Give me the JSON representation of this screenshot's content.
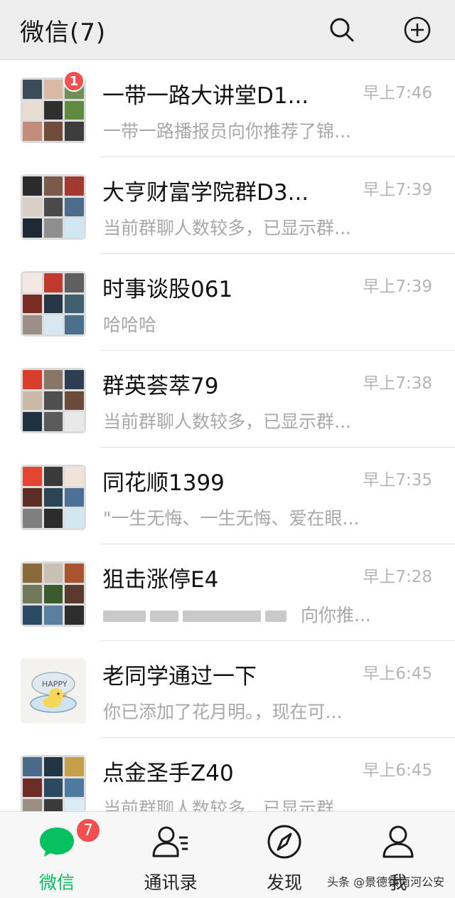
{
  "header": {
    "title": "微信(7)",
    "search_icon": "search-icon",
    "add_icon": "plus-circle-icon"
  },
  "colors": {
    "accent": "#07c160",
    "badge": "#f25050",
    "header_bg": "#ededed"
  },
  "chats": [
    {
      "name": "一带一路大讲堂D1...",
      "time": "早上7:46",
      "preview": "一带一路播报员向你推荐了锦...",
      "unread": "1"
    },
    {
      "name": "大亨财富学院群D3...",
      "time": "早上7:39",
      "preview": "当前群聊人数较多，已显示群..."
    },
    {
      "name": "时事谈股061",
      "time": "早上7:39",
      "preview": "哈哈哈"
    },
    {
      "name": "群英荟萃79",
      "time": "早上7:38",
      "preview": "当前群聊人数较多，已显示群..."
    },
    {
      "name": "同花顺1399",
      "time": "早上7:35",
      "preview": "\"一生无悔、一生无悔、爱在眼..."
    },
    {
      "name": "狙击涨停E4",
      "time": "早上7:28",
      "preview": "向你推..."
    },
    {
      "name": "老同学通过一下",
      "time": "早上6:45",
      "preview": "你已添加了花月明。，现在可..."
    },
    {
      "name": "点金圣手Z40",
      "time": "早上6:45",
      "preview": "当前群聊人数较多，已显示群..."
    }
  ],
  "tabs": [
    {
      "label": "微信",
      "icon": "chat-bubble-icon",
      "badge": "7",
      "active": true
    },
    {
      "label": "通讯录",
      "icon": "contacts-icon"
    },
    {
      "label": "发现",
      "icon": "compass-icon"
    },
    {
      "label": "我",
      "icon": "person-icon"
    }
  ],
  "watermark": "头条 @景德镇南河公安"
}
